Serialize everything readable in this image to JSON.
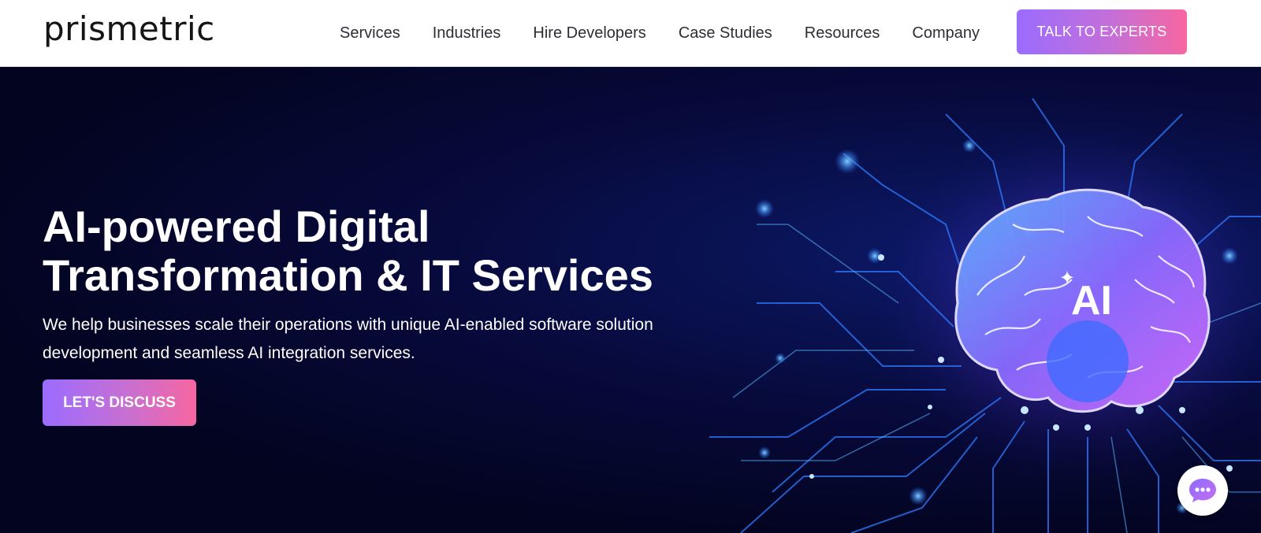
{
  "header": {
    "logo": "prismetric",
    "nav": [
      "Services",
      "Industries",
      "Hire Developers",
      "Case Studies",
      "Resources",
      "Company"
    ],
    "cta": "TALK TO EXPERTS"
  },
  "hero": {
    "title_line1": "AI-powered Digital",
    "title_line2": "Transformation & IT Services",
    "subtitle": "We help businesses scale their operations with unique AI-enabled software solution development and seamless AI integration services.",
    "cta": "LET'S DISCUSS",
    "badge": "AI"
  },
  "icons": {
    "chat": "chat-bubble-icon",
    "sparkle": "sparkle-icon",
    "brain": "brain-icon"
  },
  "colors": {
    "accent_start": "#9b6cff",
    "accent_end": "#f766a0",
    "hero_bg": "#03041f"
  }
}
